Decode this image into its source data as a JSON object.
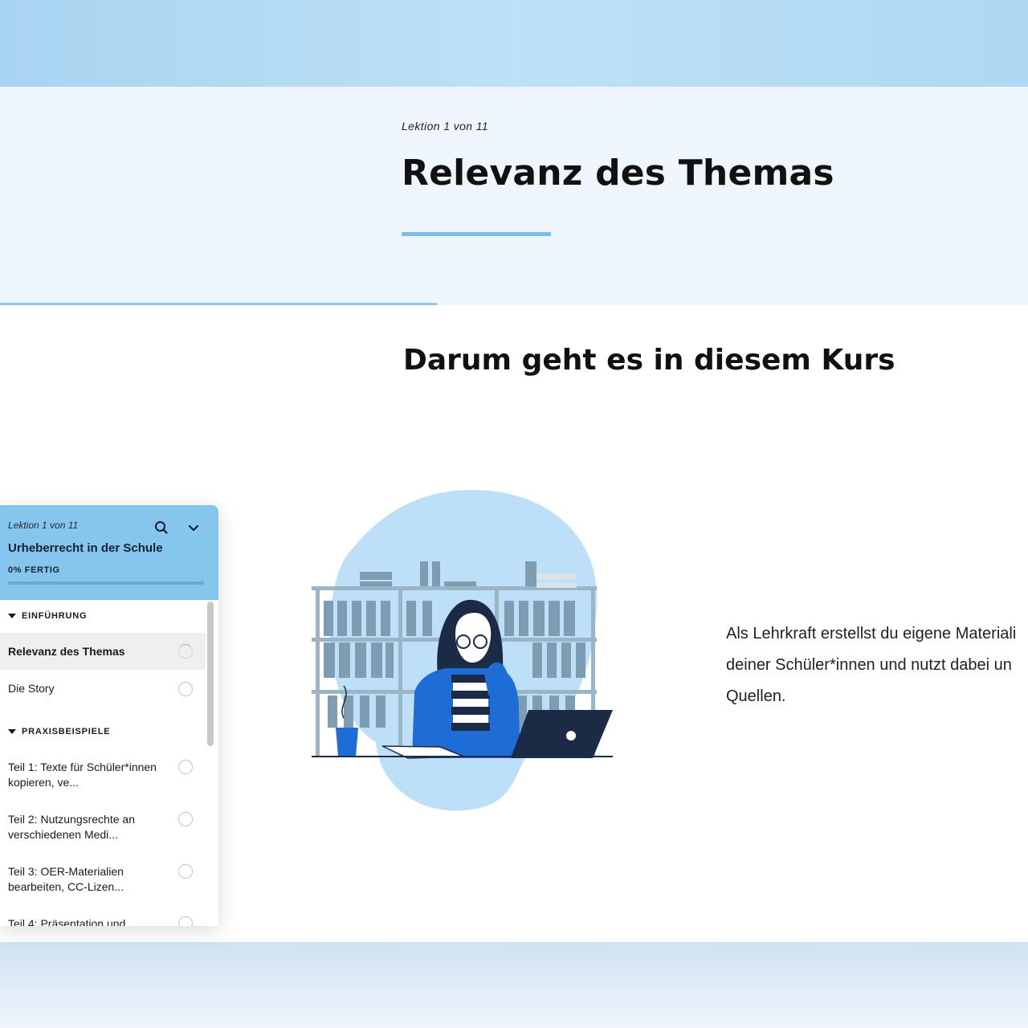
{
  "lesson": {
    "counter": "Lektion 1 von 11",
    "title": "Relevanz des Themas"
  },
  "section": {
    "heading": "Darum geht es in diesem Kurs"
  },
  "body": {
    "text": "Als Lehrkraft erstellst du eigene Materiali\ndeiner Schüler*innen und nutzt dabei un\nQuellen."
  },
  "illustration": {
    "icon": "woman-studying-illustration"
  },
  "sidebar": {
    "counter": "Lektion 1 von 11",
    "course_title": "Urheberrecht in der Schule",
    "progress_label": "0% FERTIG",
    "progress_value": 0,
    "sections": [
      {
        "title": "EINFÜHRUNG",
        "items": [
          {
            "label": "Relevanz des Themas",
            "active": true
          },
          {
            "label": "Die Story",
            "active": false
          }
        ]
      },
      {
        "title": "PRAXISBEISPIELE",
        "items": [
          {
            "label": "Teil 1: Texte für Schüler*innen kopieren, ve...",
            "active": false
          },
          {
            "label": "Teil 2: Nutzungsrechte an verschiedenen Medi...",
            "active": false
          },
          {
            "label": "Teil 3: OER-Materialien bearbeiten, CC-Lizen...",
            "active": false
          },
          {
            "label": "Teil 4: Präsentation und",
            "active": false
          }
        ]
      }
    ]
  },
  "colors": {
    "accent": "#7fbde6",
    "sidebar_header": "#86c5ee",
    "hero_bg": "#eef5fd",
    "band": "#b3dbf4"
  }
}
